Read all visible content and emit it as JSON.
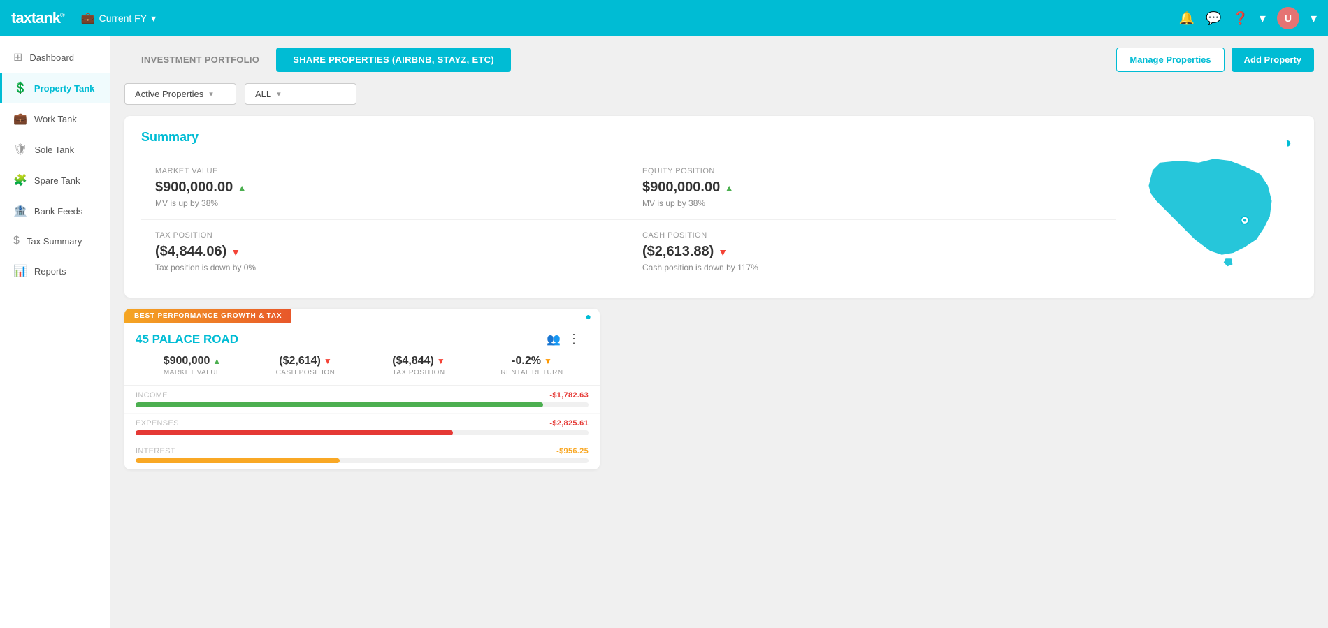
{
  "app": {
    "logo": "taxtank",
    "logo_sup": "®",
    "fy_label": "Current FY"
  },
  "topnav": {
    "icons": [
      "bell",
      "chat",
      "help",
      "chevron-down"
    ],
    "avatar_initials": "U"
  },
  "sidebar": {
    "items": [
      {
        "id": "dashboard",
        "label": "Dashboard",
        "icon": "grid"
      },
      {
        "id": "property-tank",
        "label": "Property Tank",
        "icon": "dollar-circle",
        "active": true
      },
      {
        "id": "work-tank",
        "label": "Work Tank",
        "icon": "briefcase"
      },
      {
        "id": "sole-tank",
        "label": "Sole Tank",
        "icon": "shield"
      },
      {
        "id": "spare-tank",
        "label": "Spare Tank",
        "icon": "puzzle"
      },
      {
        "id": "bank-feeds",
        "label": "Bank Feeds",
        "icon": "bank"
      },
      {
        "id": "tax-summary",
        "label": "Tax Summary",
        "icon": "dollar"
      },
      {
        "id": "reports",
        "label": "Reports",
        "icon": "bar-chart"
      }
    ]
  },
  "tabs": {
    "investment_portfolio": "INVESTMENT PORTFOLIO",
    "share_properties": "SHARE PROPERTIES (AIRBNB, STAYZ, ETC)",
    "manage_properties": "Manage Properties",
    "add_property": "Add Property"
  },
  "filters": {
    "active_properties": "Active Properties",
    "all": "ALL"
  },
  "summary": {
    "title": "Summary",
    "market_value_label": "MARKET VALUE",
    "market_value": "$900,000.00",
    "market_value_trend": "up",
    "market_value_sub": "MV is up by 38%",
    "equity_label": "EQUITY POSITION",
    "equity_value": "$900,000.00",
    "equity_trend": "up",
    "equity_sub": "MV is up by 38%",
    "tax_label": "TAX POSITION",
    "tax_value": "($4,844.06)",
    "tax_trend": "down",
    "tax_sub": "Tax position is down by 0%",
    "cash_label": "CASH POSITION",
    "cash_value": "($2,613.88)",
    "cash_trend": "down",
    "cash_sub": "Cash position is down by 117%"
  },
  "property_card": {
    "badge": "BEST PERFORMANCE GROWTH & TAX",
    "name": "45 PALACE ROAD",
    "metrics": [
      {
        "value": "$900,000",
        "trend": "up",
        "label": "MARKET VALUE"
      },
      {
        "value": "($2,614)",
        "trend": "down",
        "label": "CASH POSITION"
      },
      {
        "value": "($4,844)",
        "trend": "down",
        "label": "TAX POSITION"
      },
      {
        "value": "-0.2%",
        "trend": "down_orange",
        "label": "RENTAL RETURN"
      }
    ],
    "bars": [
      {
        "label": "INCOME",
        "value": "-$1,782.63",
        "color": "green",
        "pct": 90,
        "value_color": "red"
      },
      {
        "label": "EXPENSES",
        "value": "-$2,825.61",
        "color": "red",
        "pct": 70,
        "value_color": "red"
      },
      {
        "label": "INTEREST",
        "value": "-$956.25",
        "color": "yellow",
        "pct": 45,
        "value_color": "yellow"
      }
    ]
  }
}
